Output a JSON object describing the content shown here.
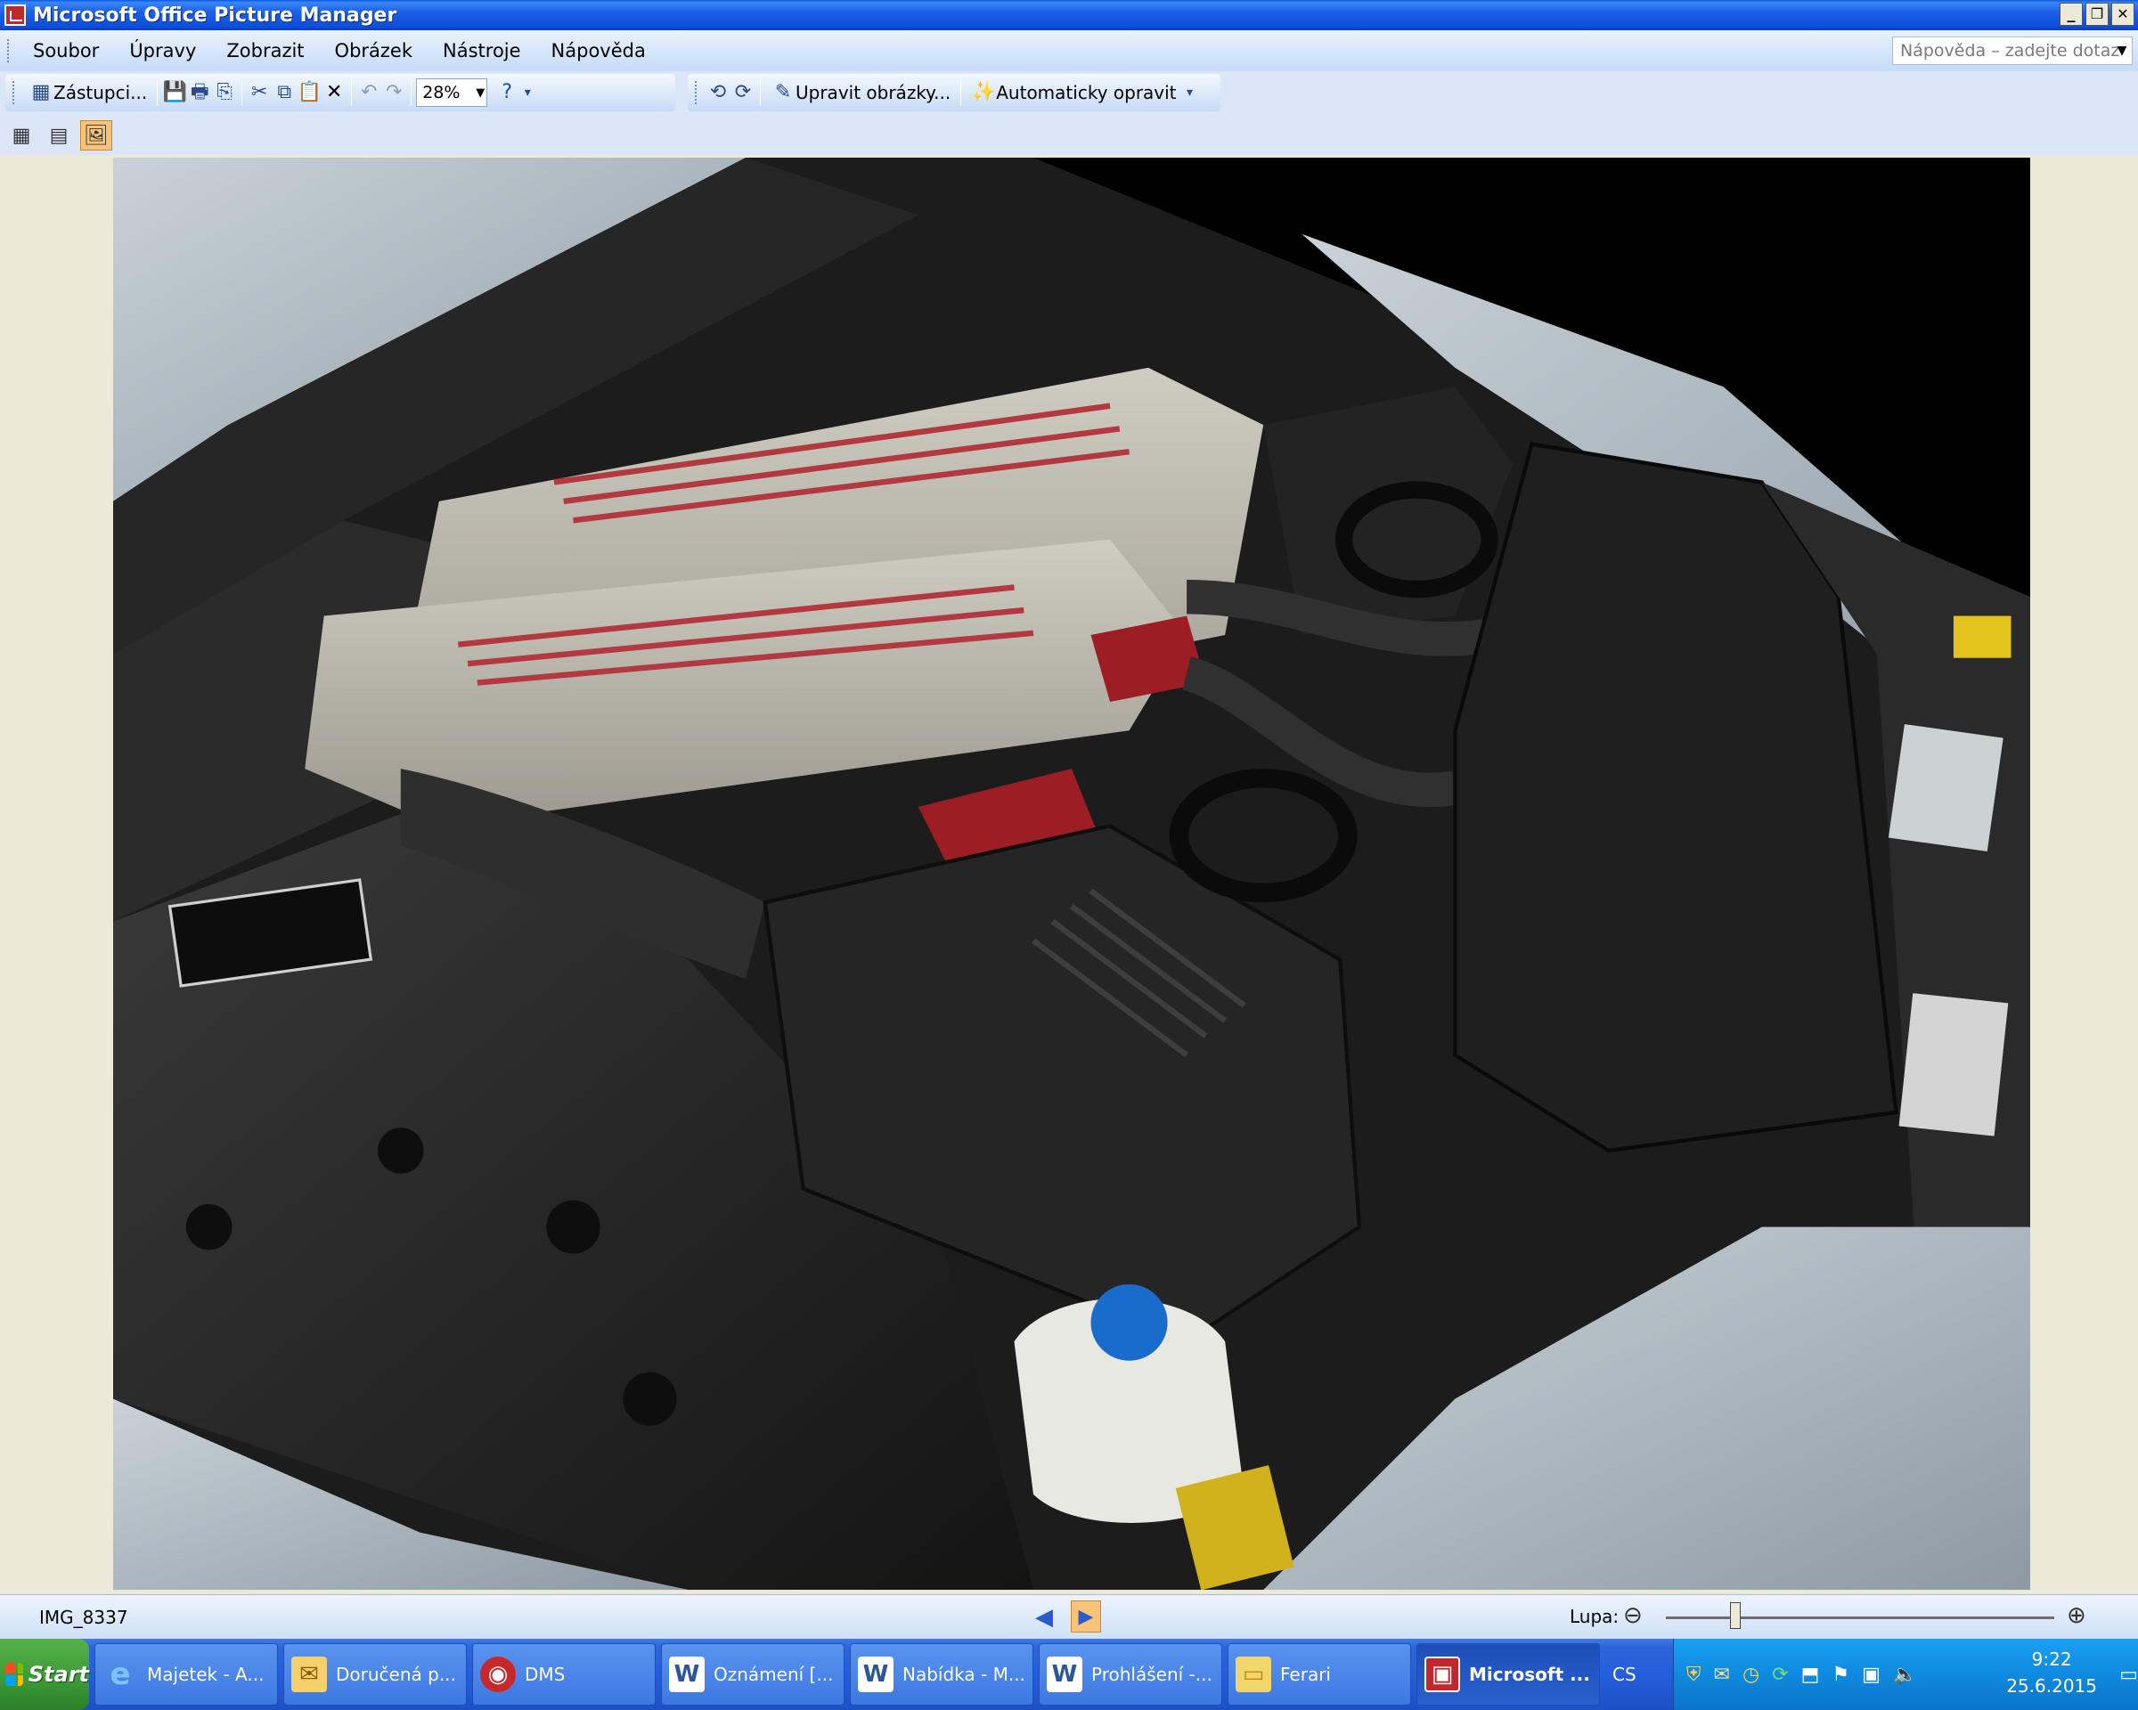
{
  "window": {
    "title": "Microsoft Office Picture Manager",
    "controls": {
      "minimize": "_",
      "restore": "❐",
      "close": "✕"
    }
  },
  "menu": {
    "items": [
      "Soubor",
      "Úpravy",
      "Zobrazit",
      "Obrázek",
      "Nástroje",
      "Nápověda"
    ],
    "help_placeholder": "Nápověda – zadejte dotaz"
  },
  "toolbar": {
    "shortcuts_label": "Zástupci...",
    "zoom_value": "28%",
    "edit_pictures_label": "Upravit obrázky...",
    "auto_correct_label": "Automaticky opravit"
  },
  "status": {
    "file_name": "IMG_8337",
    "zoom_label": "Lupa:",
    "zoom_slider_fraction": 0.18
  },
  "taskbar": {
    "start_label": "Start",
    "tasks": [
      {
        "label": "Majetek - A...",
        "icon": "ie-icon"
      },
      {
        "label": "Doručená p...",
        "icon": "outlook-icon"
      },
      {
        "label": "DMS",
        "icon": "dms-icon"
      },
      {
        "label": "Oznámení [...",
        "icon": "word-icon"
      },
      {
        "label": "Nabídka - M...",
        "icon": "word-icon"
      },
      {
        "label": "Prohlášení -...",
        "icon": "word-icon"
      },
      {
        "label": "Ferari",
        "icon": "folder-icon"
      },
      {
        "label": "Microsoft ...",
        "icon": "picture-manager-icon"
      }
    ],
    "language": "CS",
    "time": "9:22",
    "date": "25.6.2015"
  }
}
